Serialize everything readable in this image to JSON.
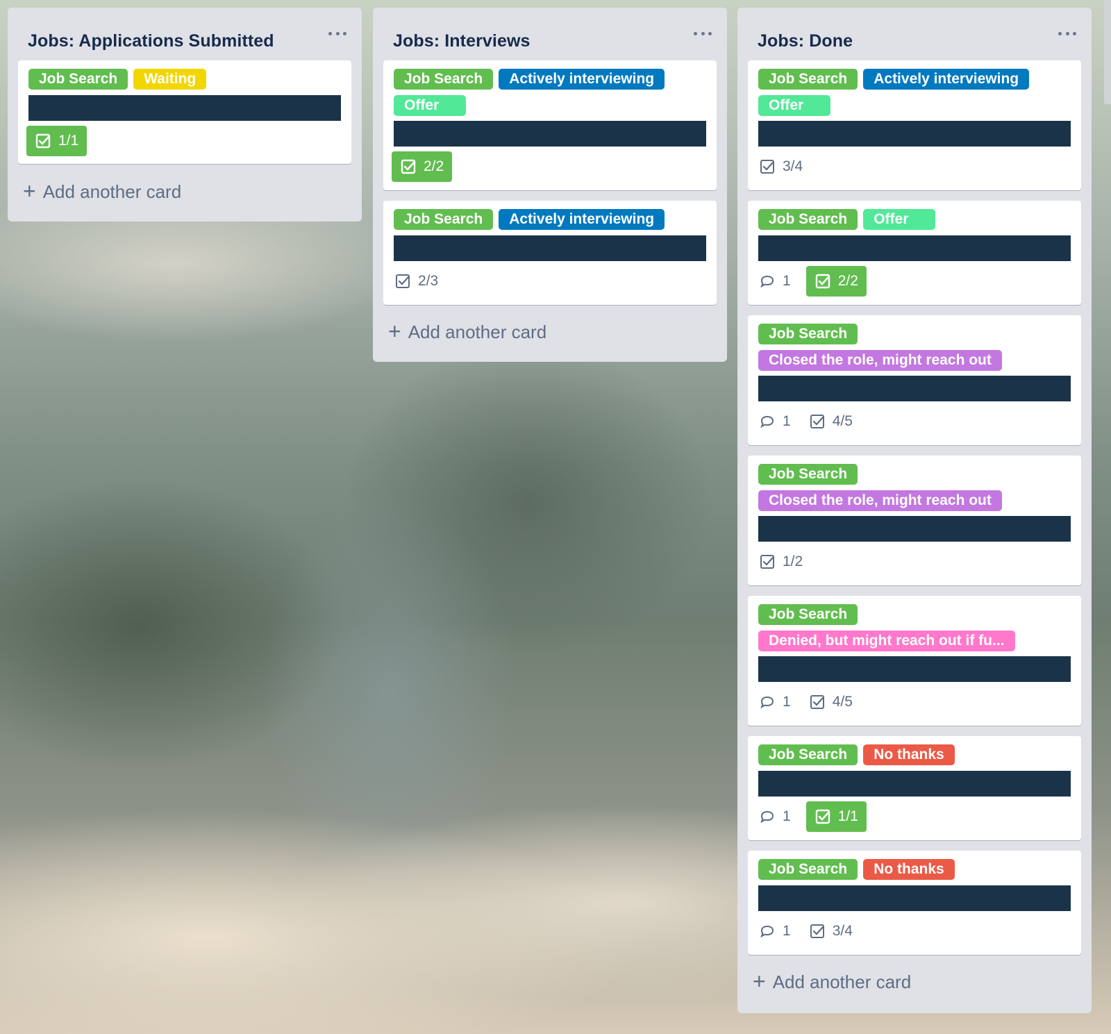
{
  "colors": {
    "green": "#61bd4f",
    "yellow": "#f2d600",
    "blue": "#0079bf",
    "light_green": "#51e898",
    "purple": "#c377e0",
    "pink": "#ff78cb",
    "red": "#eb5a46",
    "list_bg": "#dfe1e6",
    "redacted": "#1b3349",
    "title_text": "#172b4d",
    "muted_text": "#5e6c84"
  },
  "icons": {
    "list_menu": "more-horizontal-icon",
    "checklist": "checklist-icon",
    "comment": "comment-icon",
    "add": "plus-icon"
  },
  "lists": [
    {
      "title": "Jobs: Applications Submitted",
      "add_card_label": "Add another card",
      "cards": [
        {
          "labels": [
            {
              "text": "Job Search",
              "color": "green"
            },
            {
              "text": "Waiting",
              "color": "yellow"
            }
          ],
          "comments": null,
          "checklist": "1/1",
          "checklist_complete": true
        }
      ]
    },
    {
      "title": "Jobs: Interviews",
      "add_card_label": "Add another card",
      "cards": [
        {
          "labels": [
            {
              "text": "Job Search",
              "color": "green"
            },
            {
              "text": "Actively interviewing",
              "color": "blue"
            },
            {
              "text": "Offer",
              "color": "light_green"
            }
          ],
          "comments": null,
          "checklist": "2/2",
          "checklist_complete": true
        },
        {
          "labels": [
            {
              "text": "Job Search",
              "color": "green"
            },
            {
              "text": "Actively interviewing",
              "color": "blue"
            }
          ],
          "comments": null,
          "checklist": "2/3",
          "checklist_complete": false
        }
      ]
    },
    {
      "title": "Jobs: Done",
      "add_card_label": "Add another card",
      "cards": [
        {
          "labels": [
            {
              "text": "Job Search",
              "color": "green"
            },
            {
              "text": "Actively interviewing",
              "color": "blue"
            },
            {
              "text": "Offer",
              "color": "light_green"
            }
          ],
          "comments": null,
          "checklist": "3/4",
          "checklist_complete": false
        },
        {
          "labels": [
            {
              "text": "Job Search",
              "color": "green"
            },
            {
              "text": "Offer",
              "color": "light_green"
            }
          ],
          "comments": "1",
          "checklist": "2/2",
          "checklist_complete": true
        },
        {
          "labels": [
            {
              "text": "Job Search",
              "color": "green"
            },
            {
              "text": "Closed the role, might reach out",
              "color": "purple"
            }
          ],
          "comments": "1",
          "checklist": "4/5",
          "checklist_complete": false
        },
        {
          "labels": [
            {
              "text": "Job Search",
              "color": "green"
            },
            {
              "text": "Closed the role, might reach out",
              "color": "purple"
            }
          ],
          "comments": null,
          "checklist": "1/2",
          "checklist_complete": false
        },
        {
          "labels": [
            {
              "text": "Job Search",
              "color": "green"
            },
            {
              "text": "Denied, but might reach out if fu...",
              "color": "pink"
            }
          ],
          "comments": "1",
          "checklist": "4/5",
          "checklist_complete": false
        },
        {
          "labels": [
            {
              "text": "Job Search",
              "color": "green"
            },
            {
              "text": "No thanks",
              "color": "red"
            }
          ],
          "comments": "1",
          "checklist": "1/1",
          "checklist_complete": true
        },
        {
          "labels": [
            {
              "text": "Job Search",
              "color": "green"
            },
            {
              "text": "No thanks",
              "color": "red"
            }
          ],
          "comments": "1",
          "checklist": "3/4",
          "checklist_complete": false
        }
      ]
    }
  ]
}
